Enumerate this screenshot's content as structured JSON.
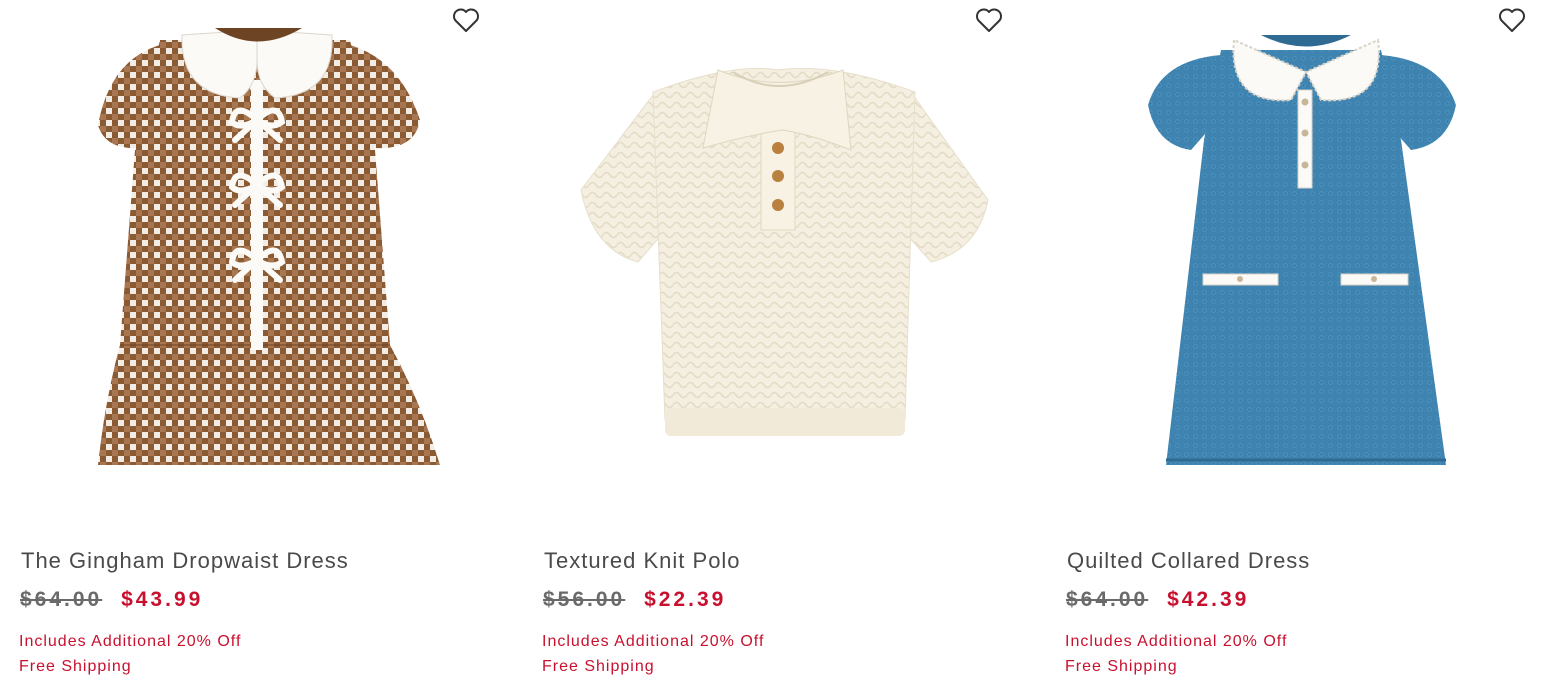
{
  "colors": {
    "title_text": "#4a4a4a",
    "original_price": "#6a6a6a",
    "sale_price": "#c8102e",
    "promo_text": "#c8102e"
  },
  "products": [
    {
      "name": "The Gingham Dropwaist Dress",
      "original_price": "$64.00",
      "sale_price": "$43.99",
      "promo": "Includes Additional 20% Off",
      "shipping": "Free Shipping",
      "image": "brown-gingham-dress",
      "favorite_icon": "heart-outline-icon"
    },
    {
      "name": "Textured Knit Polo",
      "original_price": "$56.00",
      "sale_price": "$22.39",
      "promo": "Includes Additional 20% Off",
      "shipping": "Free Shipping",
      "image": "cream-knit-polo",
      "favorite_icon": "heart-outline-icon"
    },
    {
      "name": "Quilted Collared Dress",
      "original_price": "$64.00",
      "sale_price": "$42.39",
      "promo": "Includes Additional 20% Off",
      "shipping": "Free Shipping",
      "image": "blue-quilted-dress",
      "favorite_icon": "heart-outline-icon"
    }
  ]
}
